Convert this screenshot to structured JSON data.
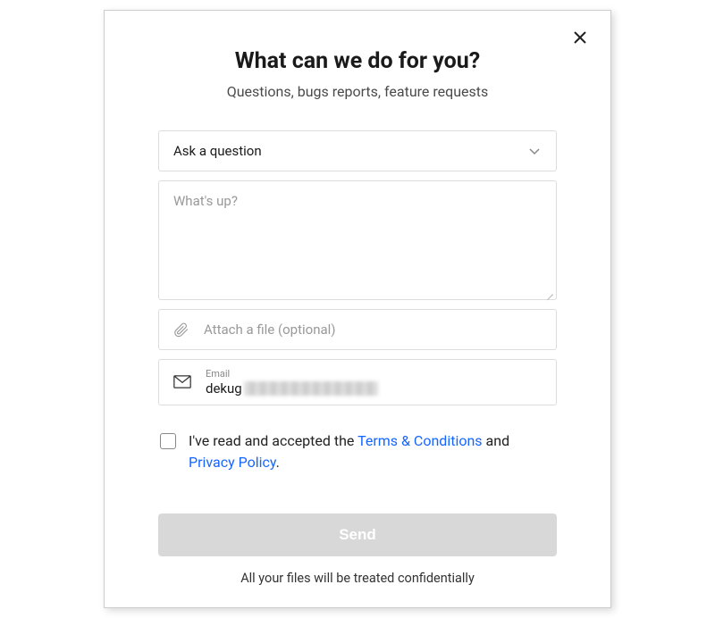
{
  "header": {
    "title": "What can we do for you?",
    "subtitle": "Questions, bugs reports, feature requests"
  },
  "form": {
    "topic_selected": "Ask a question",
    "message_placeholder": "What's up?",
    "message_value": "",
    "attach_label": "Attach a file (optional)",
    "email_label": "Email",
    "email_value_visible": "dekug"
  },
  "consent": {
    "prefix": "I've read and accepted the ",
    "terms_link": "Terms & Conditions",
    "middle": " and ",
    "privacy_link": "Privacy Policy",
    "suffix": "."
  },
  "actions": {
    "send_label": "Send"
  },
  "footer": {
    "note": "All your files will be treated confidentially"
  }
}
